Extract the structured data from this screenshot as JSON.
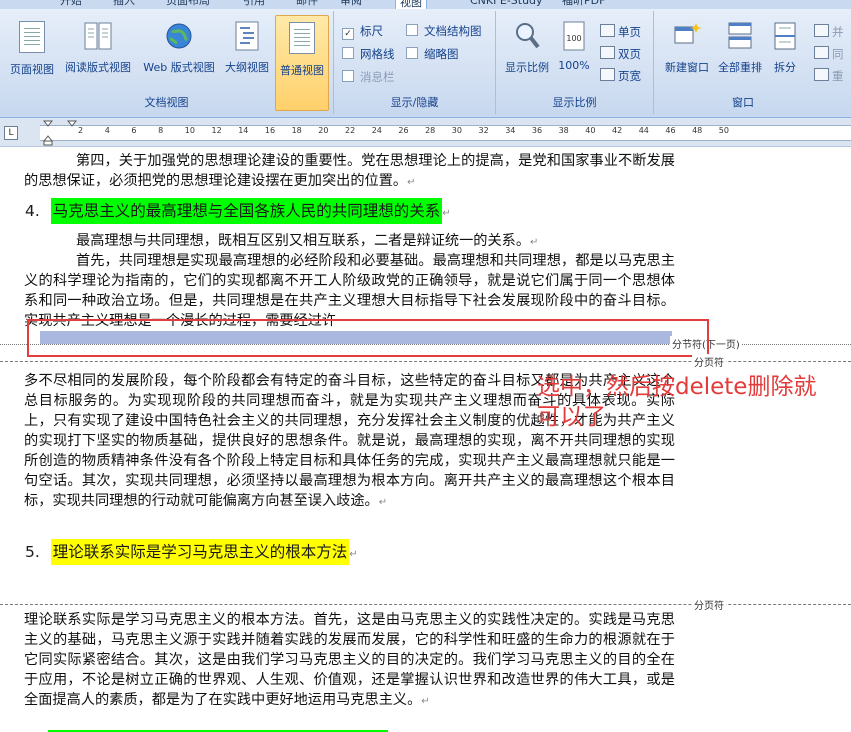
{
  "tabs": [
    "开始",
    "插入",
    "页面布局",
    "引用",
    "邮件",
    "审阅",
    "视图",
    "CNKI E-Study",
    "福昕PDF"
  ],
  "active_tab": "视图",
  "ribbon": {
    "doc_views": {
      "label": "文档视图",
      "buttons": [
        "页面视图",
        "阅读版式视图",
        "Web 版式视图",
        "大纲视图",
        "普通视图"
      ],
      "active": "普通视图"
    },
    "show_hide": {
      "label": "显示/隐藏",
      "items": [
        {
          "label": "标尺",
          "checked": true
        },
        {
          "label": "文档结构图",
          "checked": false
        },
        {
          "label": "网格线",
          "checked": false
        },
        {
          "label": "缩略图",
          "checked": false
        },
        {
          "label": "消息栏",
          "checked": false
        }
      ]
    },
    "zoom": {
      "label": "显示比例",
      "zoom_button": "显示比例",
      "percent_button": "100%",
      "percent_icon_text": "100",
      "page_buttons": [
        "单页",
        "双页",
        "页宽"
      ]
    },
    "window": {
      "label": "窗口",
      "buttons": [
        "新建窗口",
        "全部重排",
        "拆分"
      ],
      "side_buttons": [
        "并",
        "同",
        "重"
      ]
    }
  },
  "ruler": {
    "corner": "L",
    "numbers": [
      "2",
      "4",
      "6",
      "8",
      "10",
      "12",
      "14",
      "16",
      "18",
      "20",
      "22",
      "24",
      "26",
      "28",
      "30",
      "32",
      "34",
      "36",
      "38",
      "40",
      "42",
      "44",
      "46",
      "48",
      "50"
    ]
  },
  "document": {
    "para1": "第四，关于加强党的思想理论建设的重要性。党在思想理论上的提高，是党和国家事业不断发展的思想保证，必须把党的思想理论建设摆在更加突出的位置。",
    "heading4_num": "4.",
    "heading4": "马克思主义的最高理想与全国各族人民的共同理想的关系",
    "para2": "最高理想与共同理想，既相互区别又相互联系，二者是辩证统一的关系。",
    "para3": "首先，共同理想是实现最高理想的必经阶段和必要基础。最高理想和共同理想，都是以马克思主义的科学理论为指南的，它们的实现都离不开工人阶级政党的正确领导，就是说它们属于同一个思想体系和同一种政治立场。但是，共同理想是在共产主义理想大目标指导下社会发展现阶段中的奋斗目标。实现共产主义理想是一个漫长的过程，需要经过许",
    "section_break": "分节符(下一页)",
    "page_break_1": "分页符",
    "para4": "多不尽相同的发展阶段，每个阶段都会有特定的奋斗目标，这些特定的奋斗目标又都是为共产主义这个总目标服务的。为实现现阶段的共同理想而奋斗，就是为实现共产主义理想而奋斗的具体表现。实际上，只有实现了建设中国特色社会主义的共同理想，充分发挥社会主义制度的优越性，才能为共产主义的实现打下坚实的物质基础，提供良好的思想条件。就是说，最高理想的实现，离不开共同理想的实现所创造的物质精神条件没有各个阶段上特定目标和具体任务的完成，实现共产主义最高理想就只能是一句空话。其次，实现共同理想，必须坚持以最高理想为根本方向。离开共产主义的最高理想这个根本目标，实现共同理想的行动就可能偏离方向甚至误入歧途。",
    "heading5_num": "5.",
    "heading5": "理论联系实际是学习马克思主义的根本方法",
    "page_break_2": "分页符",
    "para5": "理论联系实际是学习马克思主义的根本方法。首先，这是由马克思主义的实践性决定的。实践是马克思主义的基础，马克思主义源于实践并随着实践的发展而发展，它的科学性和旺盛的生命力的根源就在于它同实际紧密结合。其次，这是由我们学习马克思主义的目的决定的。我们学习马克思主义的目的全在于应用，不论是树立正确的世界观、人生观、价值观，还是掌握认识世界和改造世界的伟大工具，或是全面提高人的素质，都是为了在实践中更好地运用马克思主义。",
    "para_mark": "↵"
  },
  "annotation": "选中，然后按delete删除就可以了",
  "colors": {
    "annotation": "#e33a3a",
    "highlight_green": "#00ff00",
    "highlight_yellow": "#ffff00",
    "selection": "#aab8e0"
  }
}
